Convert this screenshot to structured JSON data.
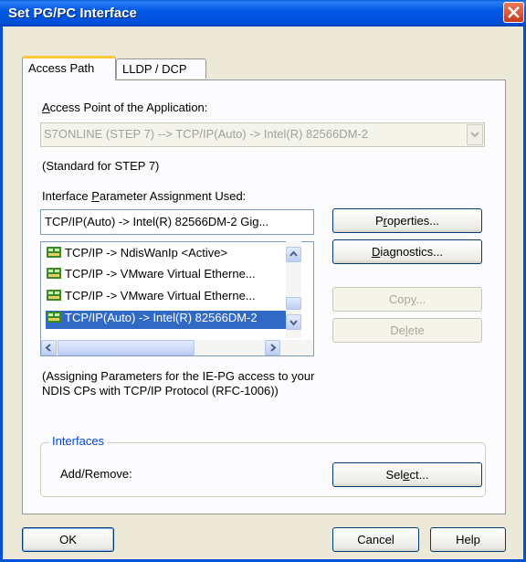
{
  "window": {
    "title": "Set PG/PC Interface"
  },
  "tabs": [
    {
      "label": "Access Path",
      "active": true
    },
    {
      "label": "LLDP / DCP",
      "active": false
    }
  ],
  "access_point": {
    "label_u": "A",
    "label_rest": "ccess Point of the Application:",
    "value": "S7ONLINE     (STEP 7)     --> TCP/IP(Auto) -> Intel(R) 82566DM-2",
    "note": "(Standard for STEP 7)"
  },
  "interface_param": {
    "label_pre": "Interface ",
    "label_u": "P",
    "label_rest": "arameter Assignment Used:",
    "value": "TCP/IP(Auto) -> Intel(R) 82566DM-2 Gig..."
  },
  "list_items": [
    {
      "label": "TCP/IP -> NdisWanIp  <Active>",
      "selected": false
    },
    {
      "label": "TCP/IP -> VMware Virtual Etherne...",
      "selected": false
    },
    {
      "label": "TCP/IP -> VMware Virtual Etherne...",
      "selected": false
    },
    {
      "label": "TCP/IP(Auto) -> Intel(R) 82566DM-2",
      "selected": true
    }
  ],
  "buttons": {
    "properties": {
      "pre": "P",
      "u": "r",
      "post": "operties..."
    },
    "diagnostics": {
      "pre": "",
      "u": "D",
      "post": "iagnostics..."
    },
    "copy": {
      "pre": "Cop",
      "u": "y",
      "post": "..."
    },
    "delete": {
      "pre": "De",
      "u": "l",
      "post": "ete"
    },
    "select": {
      "pre": "Sel",
      "u": "e",
      "post": "ct..."
    },
    "ok": "OK",
    "cancel": "Cancel",
    "help": "Help"
  },
  "description": "(Assigning Parameters for the IE-PG access to your NDIS CPs with TCP/IP Protocol (RFC-1006))",
  "interfaces_group": {
    "legend": "Interfaces",
    "add_remove_label": "Add/Remove:"
  },
  "colors": {
    "titlebar": "#0054e3",
    "selection": "#316ac5",
    "group_legend": "#0046d5"
  }
}
